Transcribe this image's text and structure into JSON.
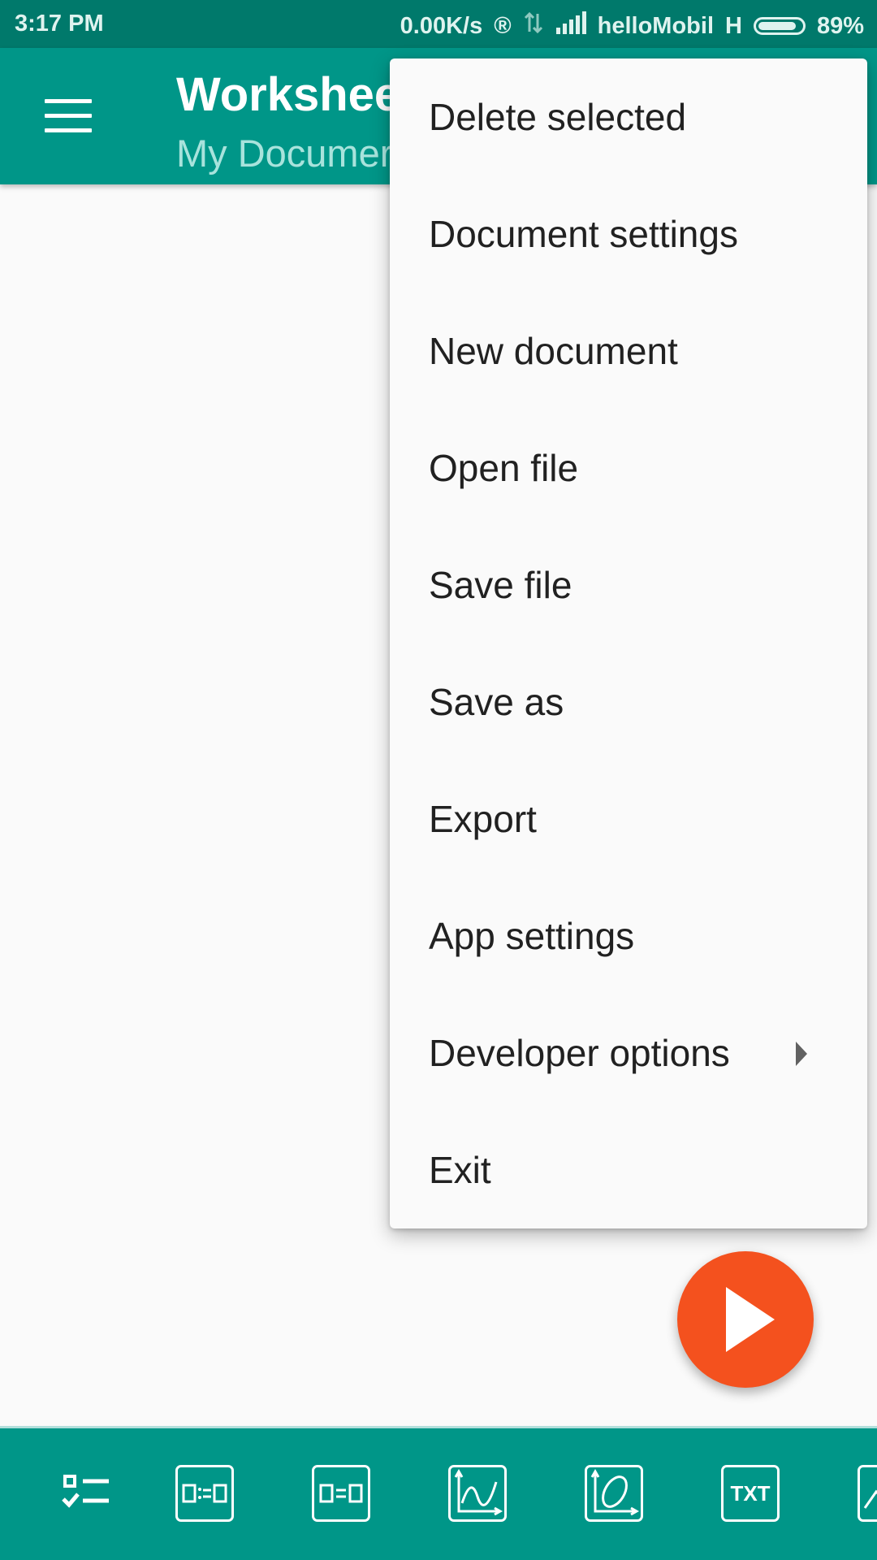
{
  "status_bar": {
    "time": "3:17 PM",
    "speed": "0.00K/s",
    "registered_symbol": "®",
    "carrier": "helloMobil",
    "network_type": "H",
    "battery_percent": "89%",
    "battery_level": 0.89
  },
  "app_bar": {
    "title": "Workshee",
    "subtitle": "My Documer"
  },
  "menu": {
    "items": [
      {
        "label": "Delete selected"
      },
      {
        "label": "Document settings"
      },
      {
        "label": "New document"
      },
      {
        "label": "Open file"
      },
      {
        "label": "Save file"
      },
      {
        "label": "Save as"
      },
      {
        "label": "Export"
      },
      {
        "label": "App settings"
      },
      {
        "label": "Developer options",
        "has_submenu": true
      },
      {
        "label": "Exit"
      }
    ]
  },
  "fab": {
    "icon": "play-icon",
    "color": "#f4511e"
  },
  "toolbar": {
    "tools": [
      {
        "icon": "checklist-icon"
      },
      {
        "icon": "assign-equation-icon"
      },
      {
        "icon": "equation-icon"
      },
      {
        "icon": "function-plot-icon"
      },
      {
        "icon": "parametric-plot-icon"
      },
      {
        "icon": "text-icon",
        "label": "TXT"
      },
      {
        "icon": "more-tools-icon"
      }
    ]
  },
  "colors": {
    "primary": "#009688",
    "primary_dark": "#00796b",
    "accent": "#f4511e"
  }
}
